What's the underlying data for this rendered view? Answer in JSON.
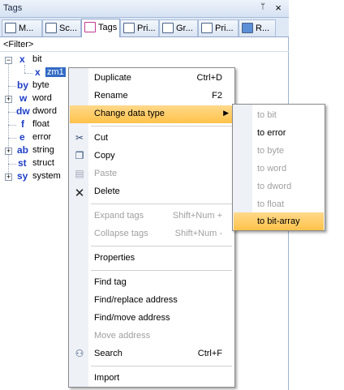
{
  "panel": {
    "title": "Tags",
    "pin_icon": "pin-icon",
    "close_icon": "close-icon",
    "tabs": [
      {
        "label": "M...",
        "icon": "monitor-icon"
      },
      {
        "label": "Sc...",
        "icon": "script-icon"
      },
      {
        "label": "Tags",
        "icon": "tags-icon"
      },
      {
        "label": "Pri...",
        "icon": "printer-icon"
      },
      {
        "label": "Gr...",
        "icon": "graph-icon"
      },
      {
        "label": "Pri...",
        "icon": "page-icon"
      },
      {
        "label": "R...",
        "icon": "bucket-icon"
      }
    ],
    "filter": "<Filter>"
  },
  "tree": [
    {
      "type_icon": "x",
      "label": "bit",
      "expander": "−"
    },
    {
      "type_icon": "x",
      "label": "zm1",
      "selected": true
    },
    {
      "type_icon": "by",
      "label": "byte"
    },
    {
      "type_icon": "w",
      "label": "word",
      "expander": "+"
    },
    {
      "type_icon": "dw",
      "label": "dword"
    },
    {
      "type_icon": "f",
      "label": "float"
    },
    {
      "type_icon": "e",
      "label": "error"
    },
    {
      "type_icon": "ab",
      "label": "string",
      "expander": "+"
    },
    {
      "type_icon": "st",
      "label": "struct"
    },
    {
      "type_icon": "sy",
      "label": "system",
      "expander": "+"
    }
  ],
  "context_menu": {
    "items": [
      {
        "label": "Duplicate",
        "shortcut": "Ctrl+D"
      },
      {
        "label": "Rename",
        "shortcut": "F2"
      },
      {
        "label": "Change data type",
        "submenu": true,
        "highlighted": true
      },
      {
        "label": "Cut",
        "icon": "scissors-icon"
      },
      {
        "label": "Copy",
        "icon": "copy-icon"
      },
      {
        "label": "Paste",
        "icon": "paste-icon",
        "disabled": true
      },
      {
        "label": "Delete",
        "icon": "delete-x-icon"
      },
      {
        "label": "Expand tags",
        "shortcut": "Shift+Num +",
        "disabled": true
      },
      {
        "label": "Collapse tags",
        "shortcut": "Shift+Num -",
        "disabled": true
      },
      {
        "label": "Properties"
      },
      {
        "label": "Find tag"
      },
      {
        "label": "Find/replace address"
      },
      {
        "label": "Find/move address"
      },
      {
        "label": "Move address",
        "disabled": true
      },
      {
        "label": "Search",
        "shortcut": "Ctrl+F",
        "icon": "binoculars-icon"
      },
      {
        "label": "Import"
      }
    ]
  },
  "submenu": {
    "items": [
      {
        "label": "to bit",
        "disabled": true
      },
      {
        "label": "to error"
      },
      {
        "label": "to byte",
        "disabled": true
      },
      {
        "label": "to word",
        "disabled": true
      },
      {
        "label": "to dword",
        "disabled": true
      },
      {
        "label": "to float",
        "disabled": true
      },
      {
        "label": "to bit-array",
        "highlighted": true
      }
    ]
  },
  "colors": {
    "accent": "#316ac5",
    "highlight": "#ffc24a",
    "tag_type": "#1f3fc7"
  }
}
